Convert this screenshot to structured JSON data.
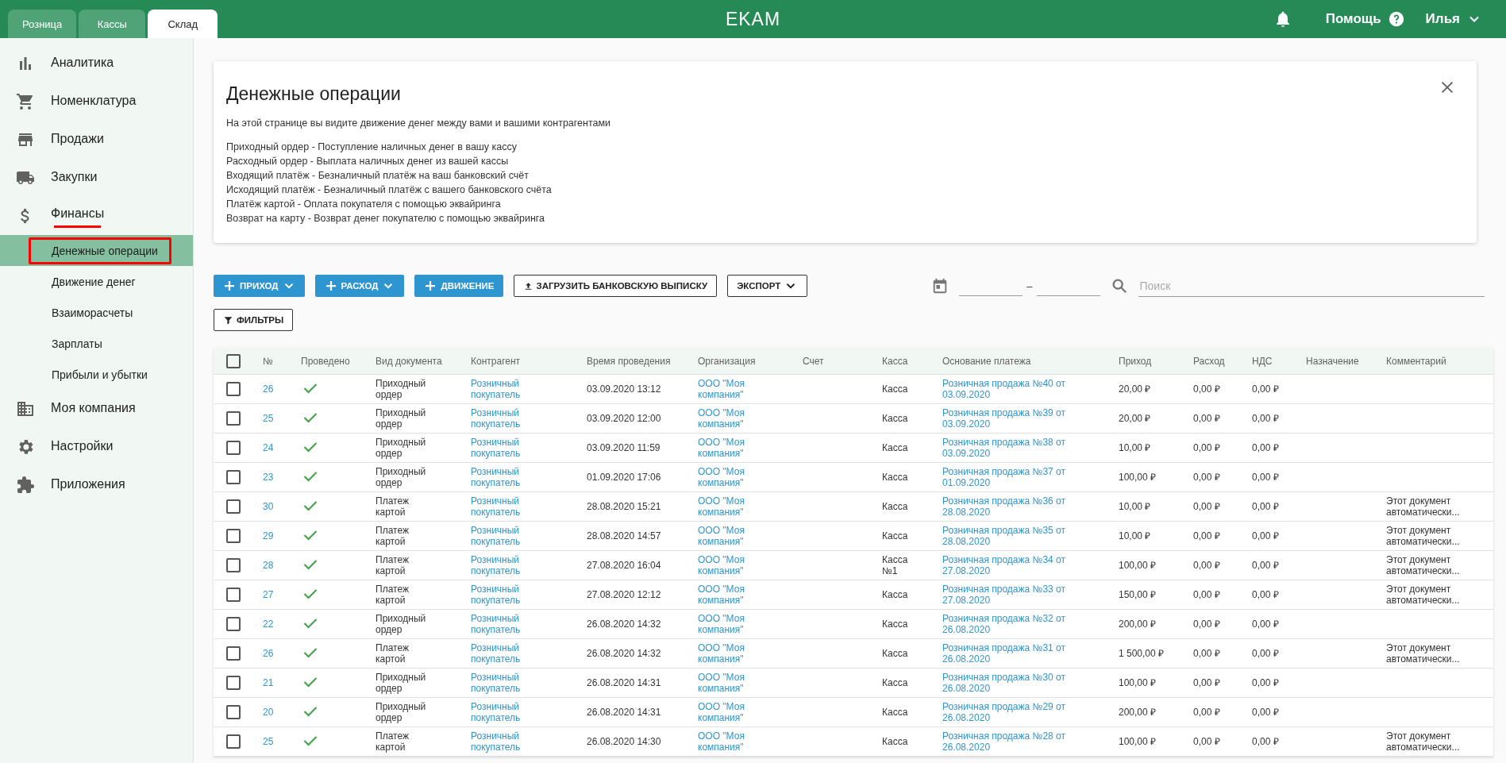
{
  "top_tabs": [
    {
      "label": "Розница",
      "selected": false
    },
    {
      "label": "Кассы",
      "selected": false
    },
    {
      "label": "Склад",
      "selected": true
    }
  ],
  "logo": "EKAM",
  "header": {
    "help": "Помощь",
    "user": "Илья"
  },
  "sidebar": {
    "items": [
      {
        "label": "Аналитика",
        "underlined": false
      },
      {
        "label": "Номенклатура",
        "underlined": false
      },
      {
        "label": "Продажи",
        "underlined": false
      },
      {
        "label": "Закупки",
        "underlined": false
      },
      {
        "label": "Финансы",
        "underlined": true,
        "children": [
          {
            "label": "Денежные операции",
            "selected": true,
            "outlined": true
          },
          {
            "label": "Движение денег",
            "selected": false,
            "outlined": false
          },
          {
            "label": "Взаиморасчеты",
            "selected": false,
            "outlined": false
          },
          {
            "label": "Зарплаты",
            "selected": false,
            "outlined": false
          },
          {
            "label": "Прибыли и убытки",
            "selected": false,
            "outlined": false
          }
        ]
      },
      {
        "label": "Моя компания",
        "underlined": false
      },
      {
        "label": "Настройки",
        "underlined": false
      },
      {
        "label": "Приложения",
        "underlined": false
      }
    ]
  },
  "info_card": {
    "title": "Денежные операции",
    "intro": "На этой странице вы видите движение денег между вами и вашими контрагентами",
    "lines": [
      "Приходный ордер - Поступление наличных денег в вашу кассу",
      "Расходный ордер - Выплата наличных денег из вашей кассы",
      "Входящий платёж - Безналичный платёж на ваш банковский счёт",
      "Исходящий платёж - Безналичный платёж с вашего банковского счёта",
      "Платёж картой - Оплата покупателя с помощью эквайринга",
      "Возврат на карту - Возврат денег покупателю с помощью эквайринга"
    ]
  },
  "toolbar": {
    "buttons": [
      {
        "label": "ПРИХОД",
        "kind": "addmenu"
      },
      {
        "label": "РАСХОД",
        "kind": "addmenu"
      },
      {
        "label": "ДВИЖЕНИЕ",
        "kind": "add"
      },
      {
        "label": "ЗАГРУЗИТЬ БАНКОВСКУЮ ВЫПИСКУ",
        "kind": "upload"
      },
      {
        "label": "ЭКСПОРТ",
        "kind": "menu"
      }
    ],
    "date_separator": "–",
    "search": {
      "placeholder": "Поиск"
    },
    "filters": "ФИЛЬТРЫ"
  },
  "table": {
    "select_all": {
      "checked": false
    },
    "columns": [
      "№",
      "Проведено",
      "Вид документа",
      "Контрагент",
      "Время проведения",
      "Организация",
      "Счет",
      "Касса",
      "Основание платежа",
      "Приход",
      "Расход",
      "НДС",
      "Назначение",
      "Комментарий"
    ],
    "rows": [
      {
        "checked": false,
        "number": "26",
        "posted": true,
        "doc_type": "Приходный ордер",
        "counterparty": "Розничный покупатель",
        "time": "03.09.2020 13:12",
        "organization": "ООО \"Моя компания\"",
        "register": "Касса",
        "basis": "Розничная продажа №40 от 03.09.2020",
        "income": "20,00 ₽",
        "expense": "0,00 ₽",
        "vat": "0,00 ₽"
      },
      {
        "checked": false,
        "number": "25",
        "posted": true,
        "doc_type": "Приходный ордер",
        "counterparty": "Розничный покупатель",
        "time": "03.09.2020 12:00",
        "organization": "ООО \"Моя компания\"",
        "register": "Касса",
        "basis": "Розничная продажа №39 от 03.09.2020",
        "income": "20,00 ₽",
        "expense": "0,00 ₽",
        "vat": "0,00 ₽"
      },
      {
        "checked": false,
        "number": "24",
        "posted": true,
        "doc_type": "Приходный ордер",
        "counterparty": "Розничный покупатель",
        "time": "03.09.2020 11:59",
        "organization": "ООО \"Моя компания\"",
        "register": "Касса",
        "basis": "Розничная продажа №38 от 03.09.2020",
        "income": "10,00 ₽",
        "expense": "0,00 ₽",
        "vat": "0,00 ₽"
      },
      {
        "checked": false,
        "number": "23",
        "posted": true,
        "doc_type": "Приходный ордер",
        "counterparty": "Розничный покупатель",
        "time": "01.09.2020 17:06",
        "organization": "ООО \"Моя компания\"",
        "register": "Касса",
        "basis": "Розничная продажа №37 от 01.09.2020",
        "income": "100,00 ₽",
        "expense": "0,00 ₽",
        "vat": "0,00 ₽"
      },
      {
        "checked": false,
        "number": "30",
        "posted": true,
        "doc_type": "Платеж картой",
        "counterparty": "Розничный покупатель",
        "time": "28.08.2020 15:21",
        "organization": "ООО \"Моя компания\"",
        "register": "Касса",
        "basis": "Розничная продажа №36 от 28.08.2020",
        "income": "10,00 ₽",
        "expense": "0,00 ₽",
        "vat": "0,00 ₽",
        "comment": "Этот документ автоматически..."
      },
      {
        "checked": false,
        "number": "29",
        "posted": true,
        "doc_type": "Платеж картой",
        "counterparty": "Розничный покупатель",
        "time": "28.08.2020 14:57",
        "organization": "ООО \"Моя компания\"",
        "register": "Касса",
        "basis": "Розничная продажа №35 от 28.08.2020",
        "income": "10,00 ₽",
        "expense": "0,00 ₽",
        "vat": "0,00 ₽",
        "comment": "Этот документ автоматически..."
      },
      {
        "checked": false,
        "number": "28",
        "posted": true,
        "doc_type": "Платеж картой",
        "counterparty": "Розничный покупатель",
        "time": "27.08.2020 16:04",
        "organization": "ООО \"Моя компания\"",
        "register": "Касса №1",
        "basis": "Розничная продажа №34 от 27.08.2020",
        "income": "100,00 ₽",
        "expense": "0,00 ₽",
        "vat": "0,00 ₽",
        "comment": "Этот документ автоматически..."
      },
      {
        "checked": false,
        "number": "27",
        "posted": true,
        "doc_type": "Платеж картой",
        "counterparty": "Розничный покупатель",
        "time": "27.08.2020 12:12",
        "organization": "ООО \"Моя компания\"",
        "register": "Касса",
        "basis": "Розничная продажа №33 от 27.08.2020",
        "income": "150,00 ₽",
        "expense": "0,00 ₽",
        "vat": "0,00 ₽",
        "comment": "Этот документ автоматически..."
      },
      {
        "checked": false,
        "number": "22",
        "posted": true,
        "doc_type": "Приходный ордер",
        "counterparty": "Розничный покупатель",
        "time": "26.08.2020 14:32",
        "organization": "ООО \"Моя компания\"",
        "register": "Касса",
        "basis": "Розничная продажа №32 от 26.08.2020",
        "income": "200,00 ₽",
        "expense": "0,00 ₽",
        "vat": "0,00 ₽"
      },
      {
        "checked": false,
        "number": "26",
        "posted": true,
        "doc_type": "Платеж картой",
        "counterparty": "Розничный покупатель",
        "time": "26.08.2020 14:32",
        "organization": "ООО \"Моя компания\"",
        "register": "Касса",
        "basis": "Розничная продажа №31 от 26.08.2020",
        "income": "1 500,00 ₽",
        "expense": "0,00 ₽",
        "vat": "0,00 ₽",
        "comment": "Этот документ автоматически..."
      },
      {
        "checked": false,
        "number": "21",
        "posted": true,
        "doc_type": "Приходный ордер",
        "counterparty": "Розничный покупатель",
        "time": "26.08.2020 14:31",
        "organization": "ООО \"Моя компания\"",
        "register": "Касса",
        "basis": "Розничная продажа №30 от 26.08.2020",
        "income": "100,00 ₽",
        "expense": "0,00 ₽",
        "vat": "0,00 ₽"
      },
      {
        "checked": false,
        "number": "20",
        "posted": true,
        "doc_type": "Приходный ордер",
        "counterparty": "Розничный покупатель",
        "time": "26.08.2020 14:31",
        "organization": "ООО \"Моя компания\"",
        "register": "Касса",
        "basis": "Розничная продажа №29 от 26.08.2020",
        "income": "200,00 ₽",
        "expense": "0,00 ₽",
        "vat": "0,00 ₽"
      },
      {
        "checked": false,
        "number": "25",
        "posted": true,
        "doc_type": "Платеж картой",
        "counterparty": "Розничный покупатель",
        "time": "26.08.2020 14:30",
        "organization": "ООО \"Моя компания\"",
        "register": "Касса",
        "basis": "Розничная продажа №28 от 26.08.2020",
        "income": "100,00 ₽",
        "expense": "0,00 ₽",
        "vat": "0,00 ₽",
        "comment": "Этот документ автоматически..."
      }
    ]
  }
}
